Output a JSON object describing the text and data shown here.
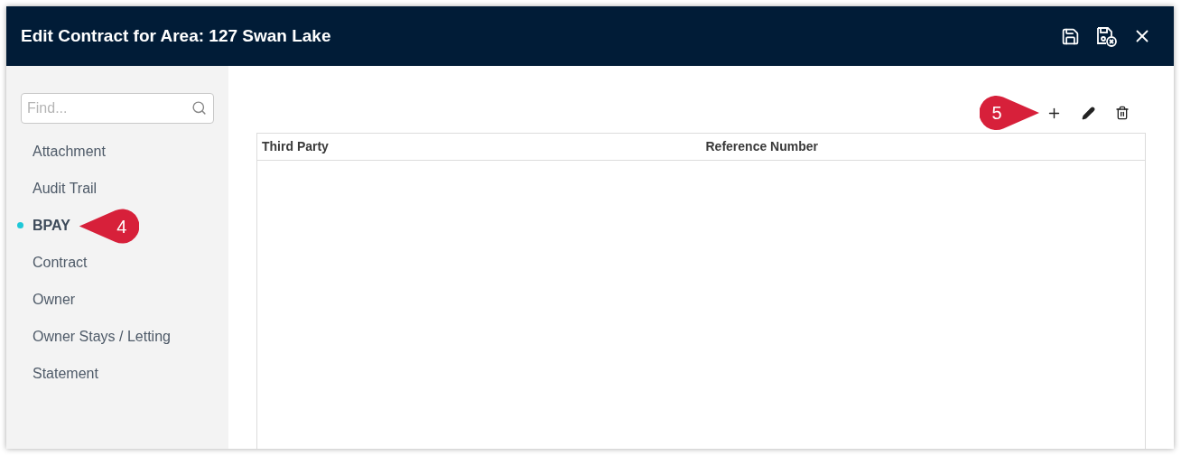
{
  "window": {
    "title": "Edit Contract for Area: 127 Swan Lake"
  },
  "sidebar": {
    "search": {
      "placeholder": "Find..."
    },
    "items": [
      {
        "label": "Attachment",
        "selected": false
      },
      {
        "label": "Audit Trail",
        "selected": false
      },
      {
        "label": "BPAY",
        "selected": true
      },
      {
        "label": "Contract",
        "selected": false
      },
      {
        "label": "Owner",
        "selected": false
      },
      {
        "label": "Owner Stays / Letting",
        "selected": false
      },
      {
        "label": "Statement",
        "selected": false
      }
    ]
  },
  "table": {
    "columns": [
      "Third Party",
      "Reference Number"
    ]
  },
  "callouts": [
    {
      "label": "4",
      "kind": "left"
    },
    {
      "label": "5",
      "kind": "right"
    }
  ]
}
